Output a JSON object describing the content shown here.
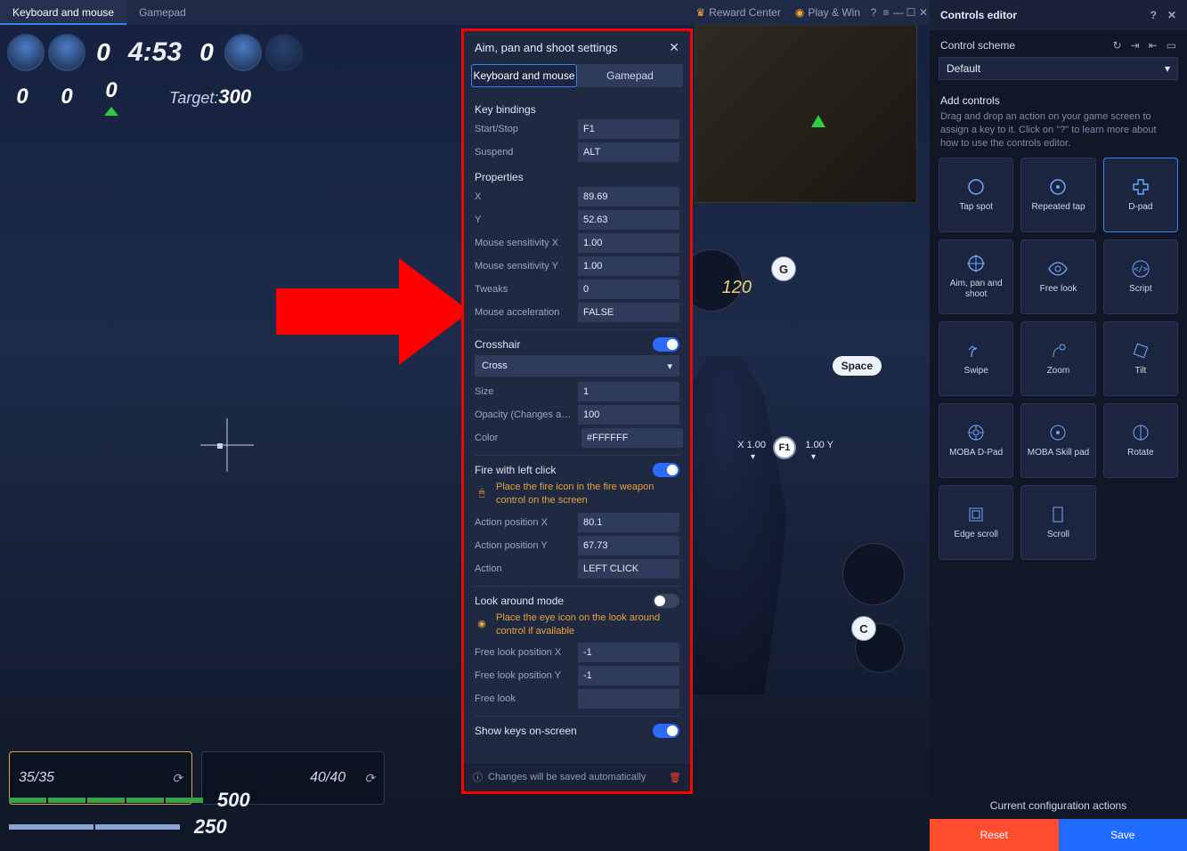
{
  "appbar": {
    "tab_keyboard": "Keyboard and mouse",
    "tab_gamepad": "Gamepad",
    "reward_center": "Reward Center",
    "play_win": "Play & Win"
  },
  "hud": {
    "timer": "4:53",
    "score_left": "0",
    "score_right": "0",
    "strip_zero_a": "0",
    "strip_zero_b": "0",
    "strip_zero_c": "0",
    "target_label": "Target:",
    "target_value": "300",
    "weapon1_ammo": "35/35",
    "weapon2_ammo": "40/40",
    "health": "500",
    "armor": "250"
  },
  "overlay": {
    "key_g": "G",
    "key_c": "C",
    "space": "Space",
    "f1": "F1",
    "x_lab": "X 1.00",
    "y_lab": "1.00 Y",
    "skill_120": "120"
  },
  "modal": {
    "title": "Aim, pan and shoot settings",
    "tab_kbm": "Keyboard and mouse",
    "tab_pad": "Gamepad",
    "key_bindings": "Key bindings",
    "start_stop": "Start/Stop",
    "start_stop_val": "F1",
    "suspend": "Suspend",
    "suspend_val": "ALT",
    "properties": "Properties",
    "x": "X",
    "x_val": "89.69",
    "y": "Y",
    "y_val": "52.63",
    "msx": "Mouse sensitivity X",
    "msx_val": "1.00",
    "msy": "Mouse sensitivity Y",
    "msy_val": "1.00",
    "tweaks": "Tweaks",
    "tweaks_val": "0",
    "maccel": "Mouse acceleration",
    "maccel_val": "FALSE",
    "crosshair": "Crosshair",
    "ch_type": "Cross",
    "size": "Size",
    "size_val": "1",
    "opacity": "Opacity (Changes ap...",
    "opacity_val": "100",
    "color": "Color",
    "color_val": "#FFFFFF",
    "fire_left": "Fire with left click",
    "fire_hint": "Place the fire icon in the fire weapon control on the screen",
    "apx": "Action position X",
    "apx_val": "80.1",
    "apy": "Action position Y",
    "apy_val": "67.73",
    "action": "Action",
    "action_val": "LEFT CLICK",
    "look_mode": "Look around mode",
    "look_hint": "Place the eye icon on the look around control if available",
    "flx": "Free look position X",
    "flx_val": "-1",
    "fly": "Free look position Y",
    "fly_val": "-1",
    "free_look": "Free look",
    "show_keys": "Show keys on-screen",
    "foot_note": "Changes will be saved automatically"
  },
  "side": {
    "title": "Controls editor",
    "scheme_label": "Control scheme",
    "scheme_value": "Default",
    "add_controls": "Add controls",
    "hint": "Drag and drop an action on your game screen to assign a key to it. Click on \"?\" to learn more about how to use the controls editor.",
    "cards": {
      "tap": "Tap spot",
      "rtap": "Repeated tap",
      "dpad": "D-pad",
      "aim": "Aim, pan and shoot",
      "freelook": "Free look",
      "script": "Script",
      "swipe": "Swipe",
      "zoom": "Zoom",
      "tilt": "Tilt",
      "moba_dpad": "MOBA D-Pad",
      "moba_skill": "MOBA Skill pad",
      "rotate": "Rotate",
      "edge": "Edge scroll",
      "scroll": "Scroll"
    },
    "foot_label": "Current configuration actions",
    "reset": "Reset",
    "save": "Save"
  }
}
